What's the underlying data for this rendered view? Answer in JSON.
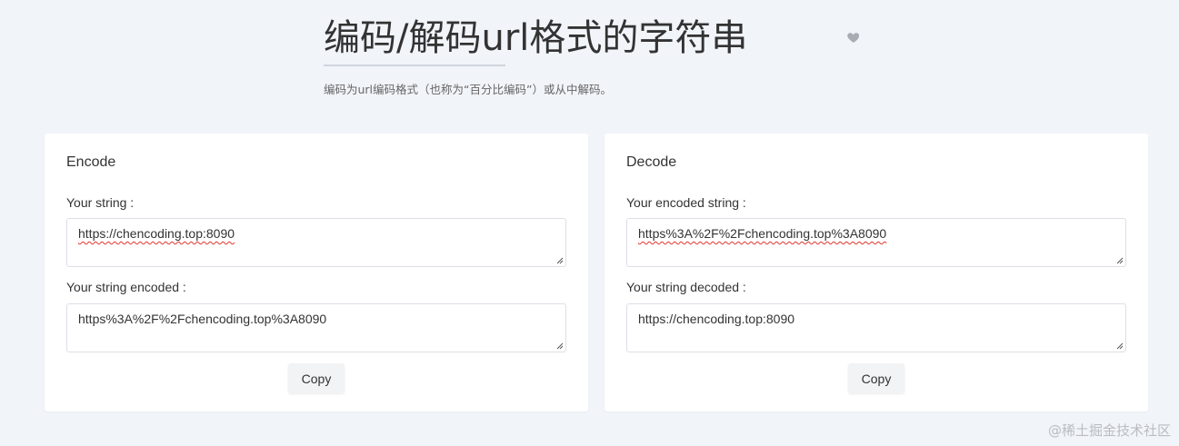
{
  "header": {
    "title": "编码/解码url格式的字符串",
    "subtitle": "编码为url编码格式（也称为“百分比编码”）或从中解码。"
  },
  "encode": {
    "title": "Encode",
    "input_label": "Your string :",
    "input_value": "https://chencoding.top:8090",
    "output_label": "Your string encoded :",
    "output_value": "https%3A%2F%2Fchencoding.top%3A8090",
    "copy_label": "Copy"
  },
  "decode": {
    "title": "Decode",
    "input_label": "Your encoded string :",
    "input_value": "https%3A%2F%2Fchencoding.top%3A8090",
    "output_label": "Your string decoded :",
    "output_value": "https://chencoding.top:8090",
    "copy_label": "Copy"
  },
  "watermark": "@稀土掘金技术社区",
  "icons": {
    "favorite": "heart-icon",
    "resize": "resize-grip-icon"
  },
  "colors": {
    "background": "#f1f4f9",
    "card": "#ffffff",
    "spellcheck": "#e0342a"
  }
}
